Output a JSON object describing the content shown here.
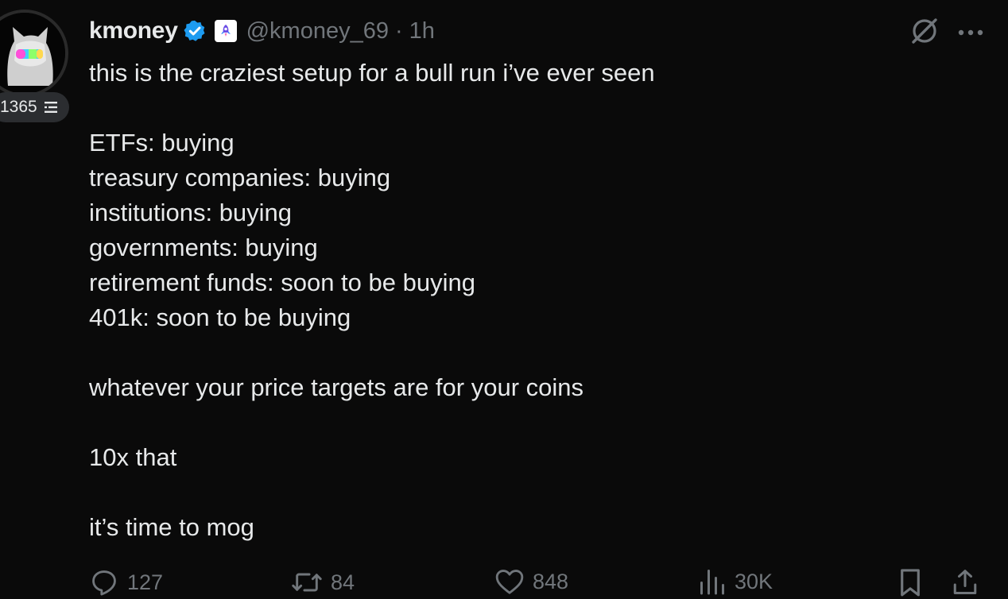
{
  "author": {
    "display_name": "kmoney",
    "handle": "@kmoney_69",
    "separator": "·",
    "timestamp": "1h",
    "verified": true,
    "score": "1365"
  },
  "icons": {
    "verified": "verified-badge-icon",
    "affiliate": "rocket-affiliate-icon",
    "grok": "grok-icon",
    "more": "more-icon",
    "reply": "reply-icon",
    "retweet": "retweet-icon",
    "like": "like-icon",
    "views": "views-icon",
    "bookmark": "bookmark-icon",
    "share": "share-icon",
    "level": "level-icon"
  },
  "colors": {
    "background": "#0a0a0a",
    "text": "#e7e9ea",
    "muted": "#71767b",
    "verified_blue": "#1d9bf0"
  },
  "tweet": {
    "lines": [
      "this is the craziest setup for a bull run i’ve ever seen",
      "",
      "ETFs: buying",
      "treasury companies: buying",
      "institutions: buying",
      "governments: buying",
      "retirement funds: soon to be buying",
      "401k: soon to be buying",
      "",
      "whatever your price targets are for your coins",
      "",
      "10x that",
      "",
      "it’s time to mog"
    ]
  },
  "stats": {
    "replies": "127",
    "retweets": "84",
    "likes": "848",
    "views": "30K"
  }
}
